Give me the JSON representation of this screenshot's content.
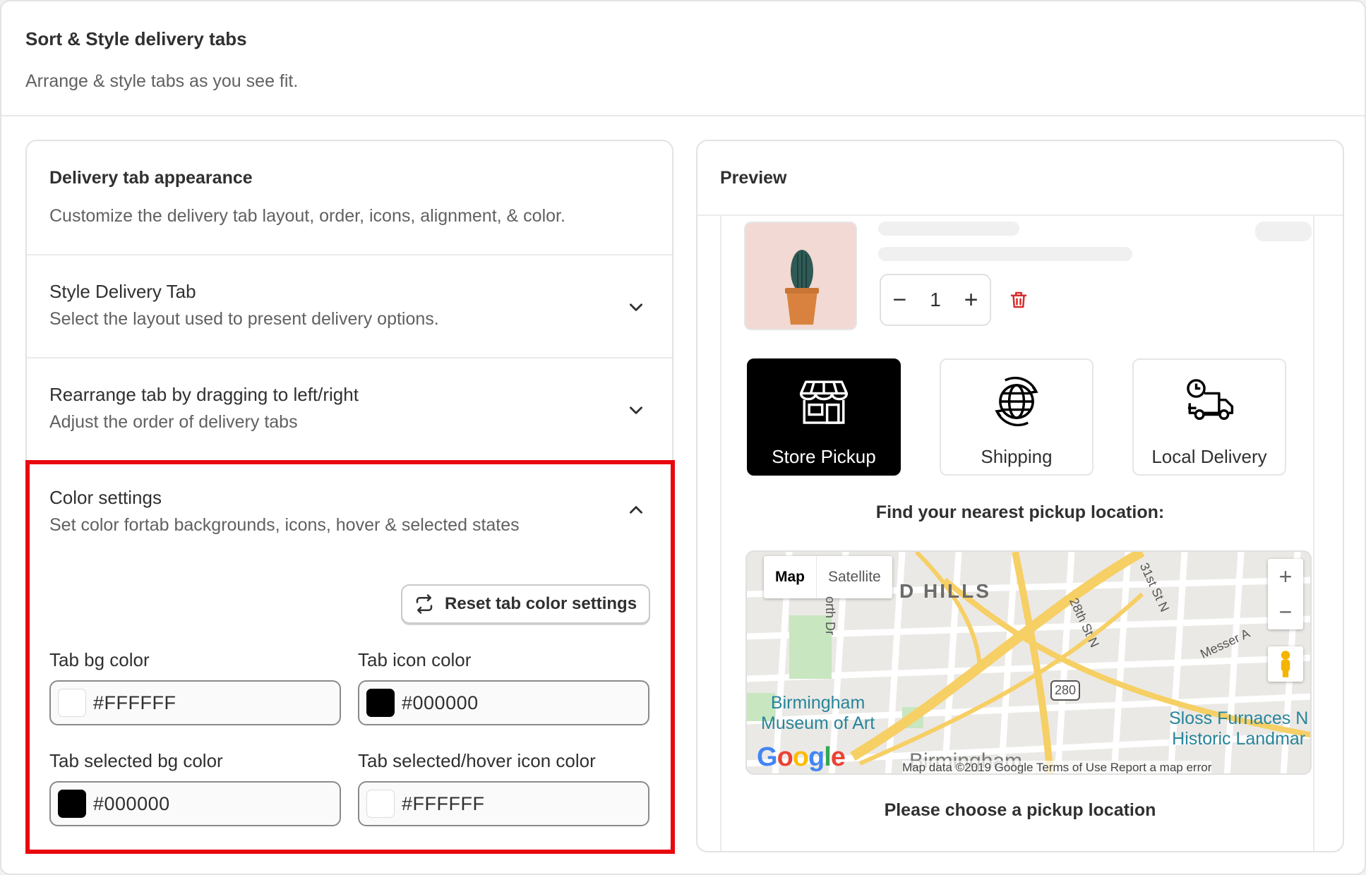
{
  "page": {
    "title": "Sort & Style delivery tabs",
    "subtitle": "Arrange & style tabs as you see fit."
  },
  "appearance": {
    "title": "Delivery tab appearance",
    "description": "Customize the delivery tab layout, order, icons, alignment, & color.",
    "sections": [
      {
        "title": "Style Delivery Tab",
        "description": "Select the layout used to present delivery options.",
        "expanded": false
      },
      {
        "title": "Rearrange tab by dragging to left/right",
        "description": "Adjust the order of delivery tabs",
        "expanded": false
      },
      {
        "title": "Color settings",
        "description": "Set color fortab backgrounds, icons, hover & selected states",
        "expanded": true
      }
    ],
    "reset_button": "Reset tab color settings",
    "color_fields": [
      {
        "label": "Tab bg color",
        "value": "#FFFFFF"
      },
      {
        "label": "Tab icon color",
        "value": "#000000"
      },
      {
        "label": "Tab selected bg color",
        "value": "#000000"
      },
      {
        "label": "Tab selected/hover icon color",
        "value": "#FFFFFF"
      }
    ]
  },
  "preview": {
    "title": "Preview",
    "quantity": "1",
    "qty_minus": "−",
    "qty_plus": "+",
    "tabs": [
      {
        "label": "Store Pickup",
        "icon": "store-icon",
        "selected": true
      },
      {
        "label": "Shipping",
        "icon": "globe-icon",
        "selected": false
      },
      {
        "label": "Local Delivery",
        "icon": "delivery-truck-icon",
        "selected": false
      }
    ],
    "find_title": "Find your nearest pickup location:",
    "map": {
      "type_map": "Map",
      "type_satellite": "Satellite",
      "zoom_in": "+",
      "zoom_out": "−",
      "area_label": "D HILLS",
      "poi_1": "Birmingham\nMuseum of Art",
      "poi_2": "Sloss Furnaces N\nHistoric Landmar",
      "street_1": "31st St N",
      "street_2": "28th St N",
      "street_3": "Messer A",
      "street_4": "orth Dr",
      "shield": "280",
      "city_label": "Birmingham",
      "logo": "Google",
      "attribution": "Map data ©2019 Google   Terms of Use   Report a map error"
    },
    "choose_text": "Please choose a pickup location"
  },
  "colors": {
    "highlight": "#e8090f",
    "trash": "#d72c2c",
    "selected_tab_bg": "#000000"
  }
}
